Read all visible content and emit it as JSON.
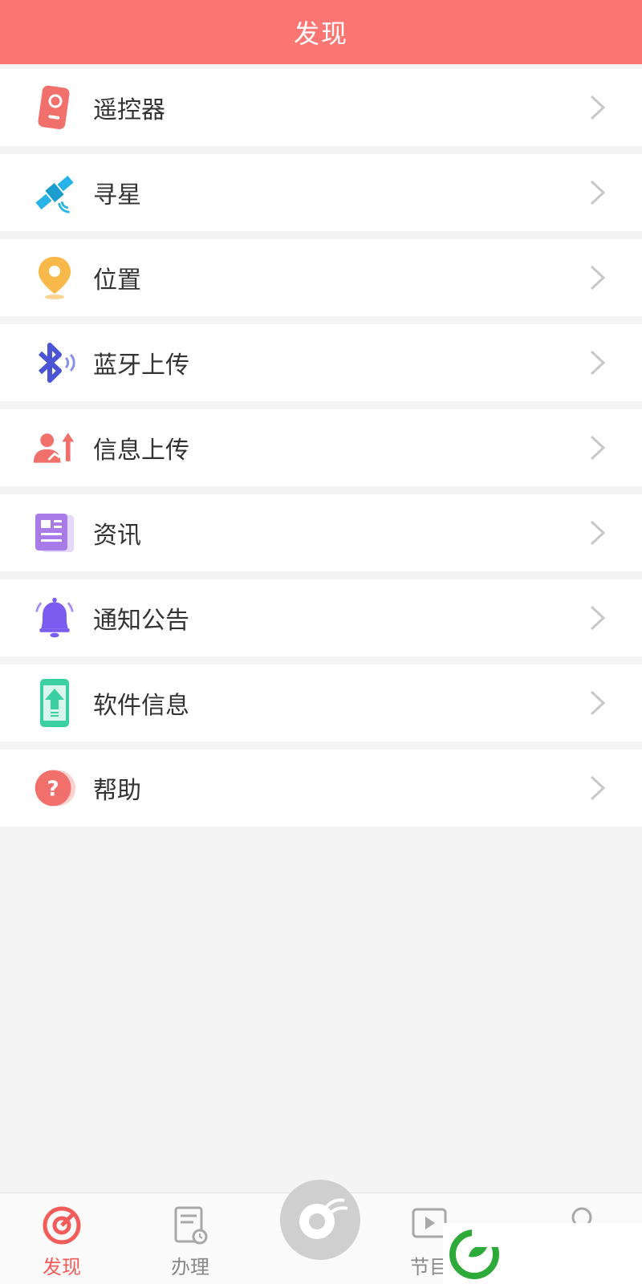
{
  "header": {
    "title": "发现"
  },
  "list": {
    "items": [
      {
        "label": "遥控器",
        "icon": "remote-control-icon"
      },
      {
        "label": "寻星",
        "icon": "satellite-icon"
      },
      {
        "label": "位置",
        "icon": "location-pin-icon"
      },
      {
        "label": "蓝牙上传",
        "icon": "bluetooth-icon"
      },
      {
        "label": "信息上传",
        "icon": "user-upload-icon"
      },
      {
        "label": "资讯",
        "icon": "news-icon"
      },
      {
        "label": "通知公告",
        "icon": "bell-icon"
      },
      {
        "label": "软件信息",
        "icon": "phone-upgrade-icon"
      },
      {
        "label": "帮助",
        "icon": "help-icon"
      }
    ]
  },
  "tabbar": {
    "tabs": [
      {
        "label": "发现",
        "icon": "discover-icon",
        "active": true
      },
      {
        "label": "办理",
        "icon": "document-clock-icon",
        "active": false
      },
      {
        "label": "",
        "icon": "center-logo-icon",
        "active": false
      },
      {
        "label": "节目",
        "icon": "play-video-icon",
        "active": false
      },
      {
        "label": "",
        "icon": "profile-icon",
        "active": false
      }
    ]
  },
  "colors": {
    "accent": "#fb7673",
    "active_tab": "#f35c59",
    "background": "#f4f4f4"
  }
}
